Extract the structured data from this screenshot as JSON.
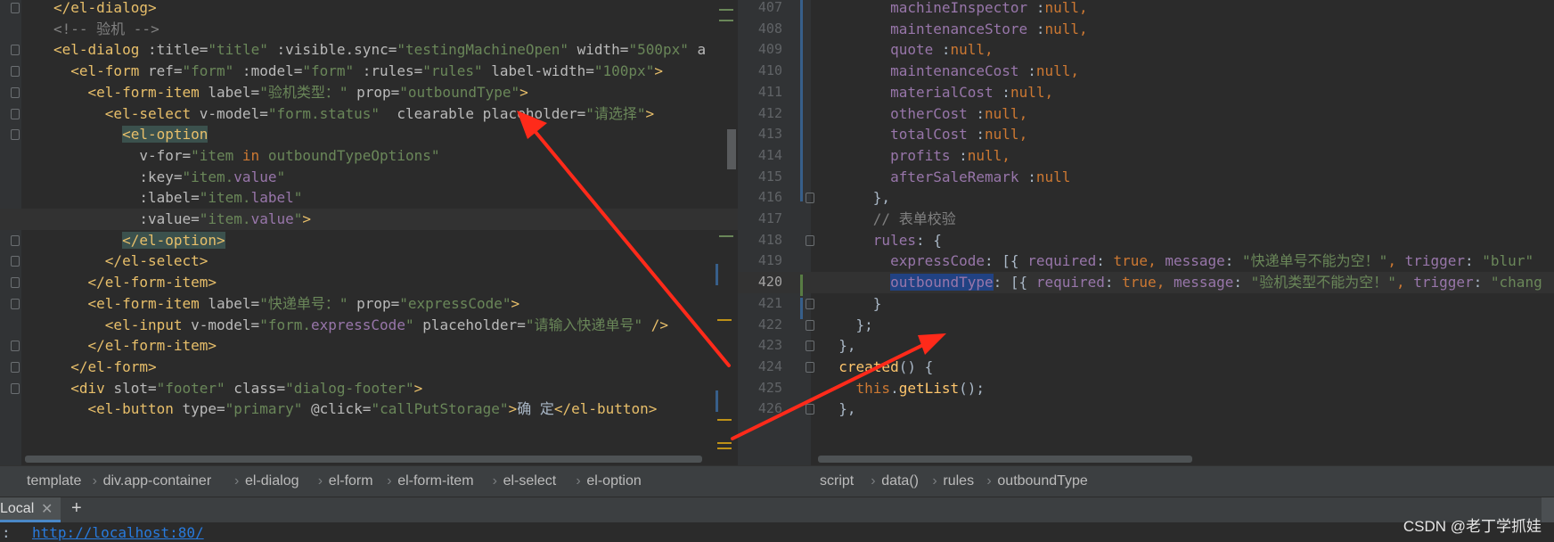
{
  "left_editor": {
    "lines": [
      [
        [
          "",
          "plain"
        ],
        [
          "</el-dialog>",
          "tag"
        ]
      ],
      [
        [
          "<!-- 验机 -->",
          "cmt"
        ]
      ],
      [
        [
          "<el-dialog ",
          "tag"
        ],
        [
          ":title=",
          "attr"
        ],
        [
          "\"title\"",
          "str"
        ],
        [
          " :visible.sync=",
          "attr"
        ],
        [
          "\"testingMachineOpen\"",
          "str"
        ],
        [
          " width=",
          "attr"
        ],
        [
          "\"500px\"",
          "str"
        ],
        [
          " a",
          "attr"
        ]
      ],
      [
        [
          "  <el-form ",
          "tag"
        ],
        [
          "ref=",
          "attr"
        ],
        [
          "\"form\"",
          "str"
        ],
        [
          " :model=",
          "attr"
        ],
        [
          "\"form\"",
          "str"
        ],
        [
          " :rules=",
          "attr"
        ],
        [
          "\"rules\"",
          "str"
        ],
        [
          " label-width=",
          "attr"
        ],
        [
          "\"100px\"",
          "str"
        ],
        [
          ">",
          "tag"
        ]
      ],
      [
        [
          "    <el-form-item ",
          "tag"
        ],
        [
          "label=",
          "attr"
        ],
        [
          "\"验机类型：\"",
          "str"
        ],
        [
          " prop=",
          "attr"
        ],
        [
          "\"outboundType\"",
          "str"
        ],
        [
          ">",
          "tag"
        ]
      ],
      [
        [
          "      <el-select ",
          "tag"
        ],
        [
          "v-model=",
          "attr"
        ],
        [
          "\"form.status\"",
          "str"
        ],
        [
          "  clearable placeholder=",
          "attr"
        ],
        [
          "\"请选择\"",
          "str"
        ],
        [
          ">",
          "tag"
        ]
      ],
      [
        [
          "        ",
          "plain"
        ],
        [
          "<el-option",
          "tag"
        ]
      ],
      [
        [
          "          v-for=",
          "attr"
        ],
        [
          "\"item ",
          "str"
        ],
        [
          "in",
          "kw"
        ],
        [
          " outboundTypeOptions\"",
          "str"
        ]
      ],
      [
        [
          "          :key=",
          "attr"
        ],
        [
          "\"item.",
          "str"
        ],
        [
          "value",
          "field"
        ],
        [
          "\"",
          "str"
        ]
      ],
      [
        [
          "          :label=",
          "attr"
        ],
        [
          "\"item.",
          "str"
        ],
        [
          "label",
          "field"
        ],
        [
          "\"",
          "str"
        ]
      ],
      [
        [
          "          :value=",
          "attr"
        ],
        [
          "\"item.",
          "str"
        ],
        [
          "value",
          "field"
        ],
        [
          "\"",
          "str"
        ],
        [
          ">",
          "tag"
        ]
      ],
      [
        [
          "        ",
          "plain"
        ],
        [
          "</el-option>",
          "tag"
        ]
      ],
      [
        [
          "      </el-select>",
          "tag"
        ]
      ],
      [
        [
          "    </el-form-item>",
          "tag"
        ]
      ],
      [
        [
          "    <el-form-item ",
          "tag"
        ],
        [
          "label=",
          "attr"
        ],
        [
          "\"快递单号：\"",
          "str"
        ],
        [
          " prop=",
          "attr"
        ],
        [
          "\"expressCode\"",
          "str"
        ],
        [
          ">",
          "tag"
        ]
      ],
      [
        [
          "      <el-input ",
          "tag"
        ],
        [
          "v-model=",
          "attr"
        ],
        [
          "\"form.",
          "str"
        ],
        [
          "expressCode",
          "field"
        ],
        [
          "\"",
          "str"
        ],
        [
          " placeholder=",
          "attr"
        ],
        [
          "\"请输入快递单号\"",
          "str"
        ],
        [
          " />",
          "tag"
        ]
      ],
      [
        [
          "    </el-form-item>",
          "tag"
        ]
      ],
      [
        [
          "  </el-form>",
          "tag"
        ]
      ],
      [
        [
          "  <div ",
          "tag"
        ],
        [
          "slot=",
          "attr"
        ],
        [
          "\"footer\"",
          "str"
        ],
        [
          " class=",
          "attr"
        ],
        [
          "\"dialog-footer\"",
          "str"
        ],
        [
          ">",
          "tag"
        ]
      ],
      [
        [
          "    <el-button ",
          "tag"
        ],
        [
          "type=",
          "attr"
        ],
        [
          "\"primary\"",
          "str"
        ],
        [
          " @click=",
          "attr"
        ],
        [
          "\"callPutStorage\"",
          "str"
        ],
        [
          ">",
          "tag"
        ],
        [
          "确 定",
          "plain"
        ],
        [
          "</el-button>",
          "tag"
        ]
      ]
    ]
  },
  "right_editor": {
    "line_numbers": [
      "407",
      "408",
      "409",
      "410",
      "411",
      "412",
      "413",
      "414",
      "415",
      "416",
      "417",
      "418",
      "419",
      "420",
      "421",
      "422",
      "423",
      "424",
      "425",
      "426"
    ],
    "lines": [
      [
        [
          "        machineInspector ",
          "field"
        ],
        [
          ":",
          "plain"
        ],
        [
          "null",
          "kw"
        ],
        [
          ",",
          "kw"
        ]
      ],
      [
        [
          "        maintenanceStore ",
          "field"
        ],
        [
          ":",
          "plain"
        ],
        [
          "null",
          "kw"
        ],
        [
          ",",
          "kw"
        ]
      ],
      [
        [
          "        quote ",
          "field"
        ],
        [
          ":",
          "plain"
        ],
        [
          "null",
          "kw"
        ],
        [
          ",",
          "kw"
        ]
      ],
      [
        [
          "        maintenanceCost ",
          "field"
        ],
        [
          ":",
          "plain"
        ],
        [
          "null",
          "kw"
        ],
        [
          ",",
          "kw"
        ]
      ],
      [
        [
          "        materialCost ",
          "field"
        ],
        [
          ":",
          "plain"
        ],
        [
          "null",
          "kw"
        ],
        [
          ",",
          "kw"
        ]
      ],
      [
        [
          "        otherCost ",
          "field"
        ],
        [
          ":",
          "plain"
        ],
        [
          "null",
          "kw"
        ],
        [
          ",",
          "kw"
        ]
      ],
      [
        [
          "        totalCost ",
          "field"
        ],
        [
          ":",
          "plain"
        ],
        [
          "null",
          "kw"
        ],
        [
          ",",
          "kw"
        ]
      ],
      [
        [
          "        profits ",
          "field"
        ],
        [
          ":",
          "plain"
        ],
        [
          "null",
          "kw"
        ],
        [
          ",",
          "kw"
        ]
      ],
      [
        [
          "        afterSaleRemark ",
          "field"
        ],
        [
          ":",
          "plain"
        ],
        [
          "null",
          "kw"
        ]
      ],
      [
        [
          "      },",
          "plain"
        ]
      ],
      [
        [
          "      // 表单校验",
          "cmt"
        ]
      ],
      [
        [
          "      rules",
          "field"
        ],
        [
          ": {",
          "plain"
        ]
      ],
      [
        [
          "        expressCode",
          "field"
        ],
        [
          ": [{ ",
          "plain"
        ],
        [
          "required",
          "field"
        ],
        [
          ": ",
          "plain"
        ],
        [
          "true",
          "kw"
        ],
        [
          ", ",
          "kw"
        ],
        [
          "message",
          "field"
        ],
        [
          ": ",
          "plain"
        ],
        [
          "\"快递单号不能为空！\"",
          "str"
        ],
        [
          ", ",
          "kw"
        ],
        [
          "trigger",
          "field"
        ],
        [
          ": ",
          "plain"
        ],
        [
          "\"blur\"",
          "str"
        ]
      ],
      [
        [
          "        ",
          "plain"
        ],
        [
          "outboundType",
          "field"
        ],
        [
          ": [{ ",
          "plain"
        ],
        [
          "required",
          "field"
        ],
        [
          ": ",
          "plain"
        ],
        [
          "true",
          "kw"
        ],
        [
          ", ",
          "kw"
        ],
        [
          "message",
          "field"
        ],
        [
          ": ",
          "plain"
        ],
        [
          "\"验机类型不能为空！\"",
          "str"
        ],
        [
          ", ",
          "kw"
        ],
        [
          "trigger",
          "field"
        ],
        [
          ": ",
          "plain"
        ],
        [
          "\"chang",
          "str"
        ]
      ],
      [
        [
          "      }",
          "plain"
        ]
      ],
      [
        [
          "    };",
          "plain"
        ]
      ],
      [
        [
          "  },",
          "plain"
        ]
      ],
      [
        [
          "  ",
          "plain"
        ],
        [
          "created",
          "fn"
        ],
        [
          "() {",
          "plain"
        ]
      ],
      [
        [
          "    ",
          "plain"
        ],
        [
          "this",
          "kw"
        ],
        [
          ".",
          "plain"
        ],
        [
          "getList",
          "fn"
        ],
        [
          "();",
          "plain"
        ]
      ],
      [
        [
          "  },",
          "plain"
        ]
      ]
    ]
  },
  "breadcrumbs_left": [
    "template",
    "div.app-container",
    "el-dialog",
    "el-form",
    "el-form-item",
    "el-select",
    "el-option"
  ],
  "breadcrumbs_right": [
    "script",
    "data()",
    "rules",
    "outboundType"
  ],
  "terminal": {
    "tab_label": "Local",
    "output_prefix": ":",
    "output_url": "http://localhost:80/"
  },
  "watermark": "CSDN @老丁学抓娃",
  "colors": {
    "background": "#2b2b2b",
    "annotation_arrow": "#ff2a1a",
    "selection": "#214283",
    "tag": "#e8bf6a",
    "string": "#6a8759",
    "keyword": "#cc7832",
    "field": "#9876aa"
  }
}
